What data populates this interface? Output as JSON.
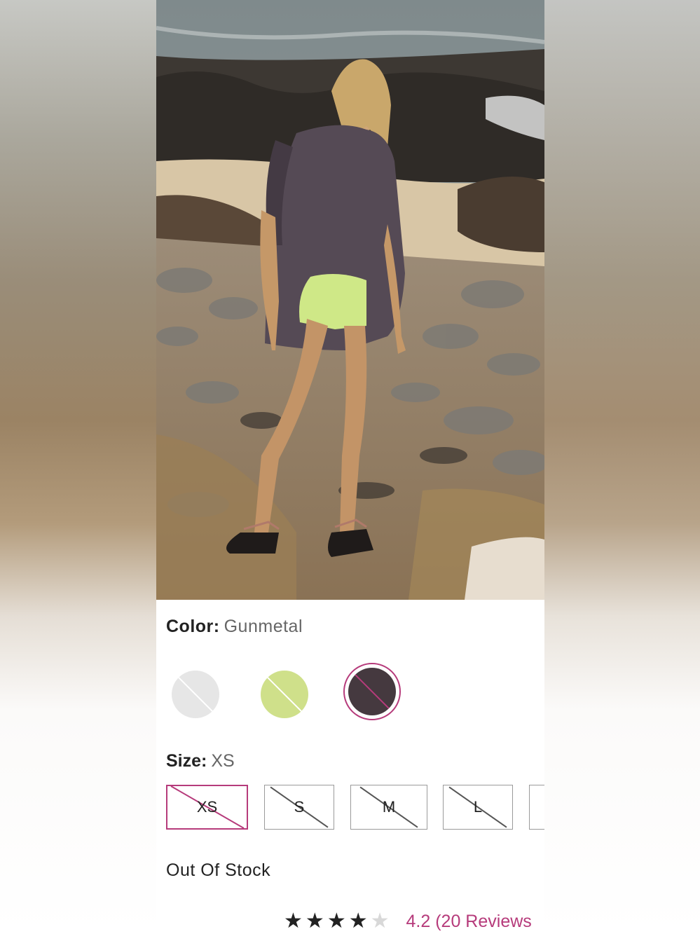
{
  "product": {
    "color_label": "Color:",
    "color_value": "Gunmetal",
    "size_label": "Size:",
    "size_value": "XS",
    "stock_status": "Out Of Stock"
  },
  "swatches": [
    {
      "name": "white",
      "color": "#e6e6e6",
      "selected": false,
      "unavailable": true
    },
    {
      "name": "lime",
      "color": "#cfe08a",
      "selected": false,
      "unavailable": true
    },
    {
      "name": "gunmetal",
      "color": "#45393f",
      "selected": true,
      "unavailable": true
    }
  ],
  "sizes": [
    {
      "label": "XS",
      "selected": true,
      "unavailable": true
    },
    {
      "label": "S",
      "selected": false,
      "unavailable": true
    },
    {
      "label": "M",
      "selected": false,
      "unavailable": true
    },
    {
      "label": "L",
      "selected": false,
      "unavailable": true
    }
  ],
  "rating": {
    "stars_filled": 4,
    "stars_total": 5,
    "text": "4.2 (20 Reviews"
  },
  "colors": {
    "accent": "#b63b7b"
  }
}
